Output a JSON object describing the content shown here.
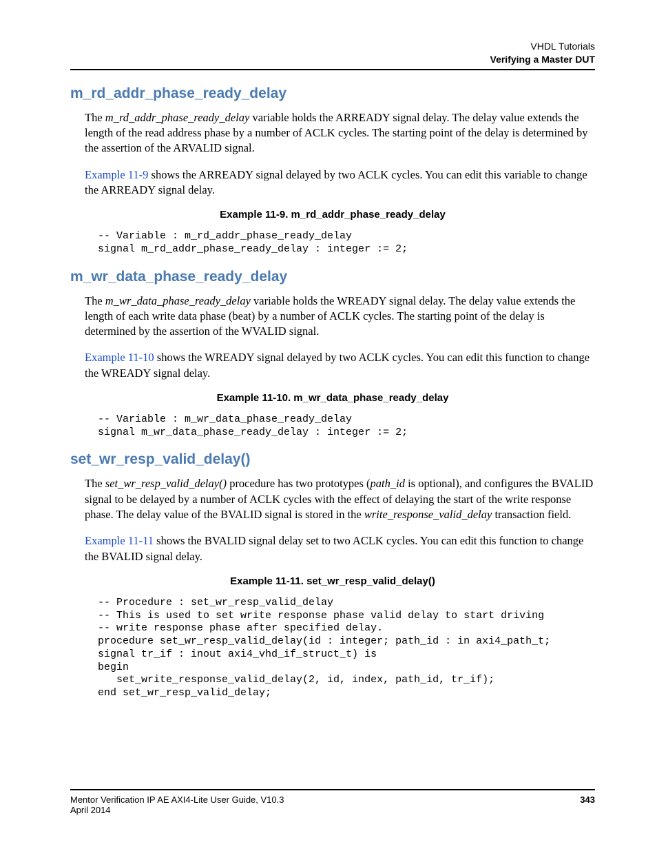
{
  "header": {
    "line1": "VHDL Tutorials",
    "line2": "Verifying a Master DUT"
  },
  "sections": [
    {
      "heading": "m_rd_addr_phase_ready_delay",
      "para1_a": "The ",
      "para1_b": "m_rd_addr_phase_ready_delay",
      "para1_c": " variable holds the ARREADY signal delay. The delay value extends the length of the read address phase by a number of ACLK cycles. The starting point of the delay is determined by the assertion of the ARVALID signal.",
      "para2_a": "Example 11-9",
      "para2_b": " shows the ARREADY signal delayed by two ACLK cycles. You can edit this variable to change the ARREADY signal delay.",
      "example_title": "Example 11-9. m_rd_addr_phase_ready_delay",
      "code": "-- Variable : m_rd_addr_phase_ready_delay\nsignal m_rd_addr_phase_ready_delay : integer := 2;"
    },
    {
      "heading": "m_wr_data_phase_ready_delay",
      "para1_a": "The ",
      "para1_b": "m_wr_data_phase_ready_delay",
      "para1_c": " variable holds the WREADY signal delay. The delay value extends the length of each write data phase (beat) by a number of ACLK cycles. The starting point of the delay is determined by the assertion of the WVALID signal.",
      "para2_a": "Example 11-10",
      "para2_b": " shows the WREADY signal delayed by two ACLK cycles. You can edit this function to change the WREADY signal delay.",
      "example_title": "Example 11-10. m_wr_data_phase_ready_delay",
      "code": "-- Variable : m_wr_data_phase_ready_delay\nsignal m_wr_data_phase_ready_delay : integer := 2;"
    },
    {
      "heading": "set_wr_resp_valid_delay()",
      "para1_a": "The ",
      "para1_b": "set_wr_resp_valid_delay()",
      "para1_c": " procedure has two prototypes (",
      "para1_d": "path_id",
      "para1_e": " is optional), and configures the BVALID signal to be delayed by a number of ACLK cycles with the effect of delaying the start of the write response phase. The delay value of the BVALID signal is stored in the ",
      "para1_f": "write_response_valid_delay",
      "para1_g": " transaction field.",
      "para2_a": "Example 11-11",
      "para2_b": " shows the BVALID signal delay set to two ACLK cycles. You can edit this function to change the BVALID signal delay.",
      "example_title": "Example 11-11. set_wr_resp_valid_delay()",
      "code": "-- Procedure : set_wr_resp_valid_delay\n-- This is used to set write response phase valid delay to start driving\n-- write response phase after specified delay.\nprocedure set_wr_resp_valid_delay(id : integer; path_id : in axi4_path_t;\nsignal tr_if : inout axi4_vhd_if_struct_t) is\nbegin\n   set_write_response_valid_delay(2, id, index, path_id, tr_if);\nend set_wr_resp_valid_delay;"
    }
  ],
  "footer": {
    "guide": "Mentor Verification IP AE AXI4-Lite User Guide, V10.3",
    "page": "343",
    "date": "April 2014"
  }
}
